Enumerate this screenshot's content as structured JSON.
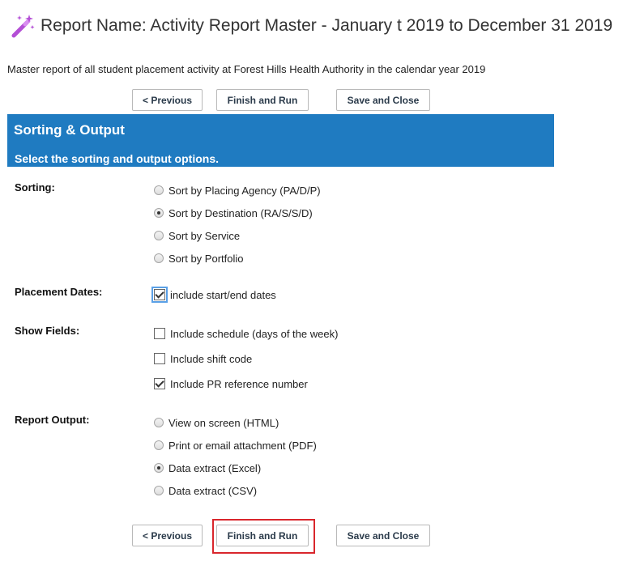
{
  "header": {
    "title": "Report Name: Activity Report Master - January t 2019 to December 31 2019",
    "description": "Master report of all student placement activity at Forest Hills Health Authority in the calendar year 2019",
    "icon": "magic-wand-icon"
  },
  "buttons": {
    "previous": "< Previous",
    "finish_run": "Finish and Run",
    "save_close": "Save and Close"
  },
  "panel": {
    "title": "Sorting & Output",
    "subtitle": "Select the sorting and output options."
  },
  "sections": {
    "sorting": {
      "label": "Sorting:",
      "options": [
        {
          "label": "Sort by Placing Agency (PA/D/P)",
          "selected": false
        },
        {
          "label": "Sort by Destination (RA/S/S/D)",
          "selected": true
        },
        {
          "label": "Sort by Service",
          "selected": false
        },
        {
          "label": "Sort by Portfolio",
          "selected": false
        }
      ]
    },
    "placement_dates": {
      "label": "Placement Dates:",
      "options": [
        {
          "label": "include start/end dates",
          "checked": true
        }
      ]
    },
    "show_fields": {
      "label": "Show Fields:",
      "options": [
        {
          "label": "Include schedule (days of the week)",
          "checked": false
        },
        {
          "label": "Include shift code",
          "checked": false
        },
        {
          "label": "Include PR reference number",
          "checked": true
        }
      ]
    },
    "report_output": {
      "label": "Report Output:",
      "options": [
        {
          "label": "View on screen (HTML)",
          "selected": false
        },
        {
          "label": "Print or email attachment (PDF)",
          "selected": false
        },
        {
          "label": "Data extract (Excel)",
          "selected": true
        },
        {
          "label": "Data extract (CSV)",
          "selected": false
        }
      ]
    }
  },
  "colors": {
    "panel_bg": "#1f7bc1",
    "highlight": "#d9262c",
    "wand": "#b44fd6"
  }
}
